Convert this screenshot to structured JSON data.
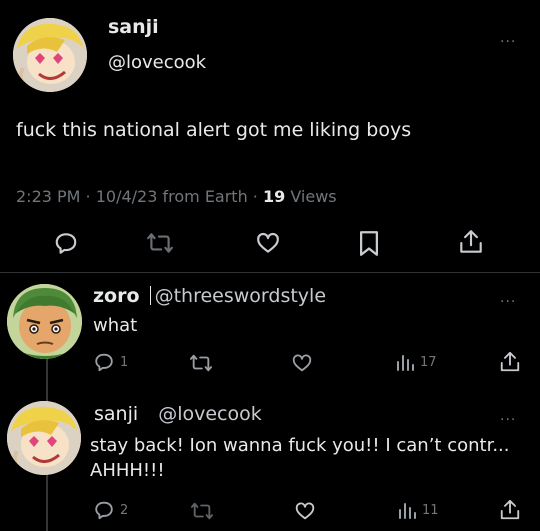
{
  "main_post": {
    "display_name": "sanji",
    "handle": "@lovecook",
    "text": "fuck this national alert got me liking boys",
    "meta_time": "2:23 PM · 10/4/23 from Earth · ",
    "views_count": "19",
    "views_label": " Views"
  },
  "reply1": {
    "display_name": "zoro",
    "handle": "@threeswordstyle",
    "text": "what",
    "reply_count": "1",
    "views_count": "17"
  },
  "reply2": {
    "display_name": "sanji",
    "handle": "@lovecook",
    "text": "stay back! Ion wanna fuck you!! I can’t contr... AHHH!!!",
    "reply_count": "2",
    "views_count": "11"
  },
  "more_glyph": "···",
  "colors": {
    "background": "#000000",
    "text": "#e7e9ea",
    "muted": "#71767b"
  }
}
